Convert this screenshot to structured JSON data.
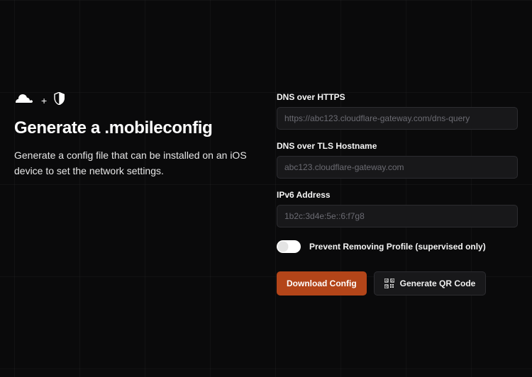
{
  "logos": {
    "plus": "+"
  },
  "left": {
    "title": "Generate a .mobileconfig",
    "subtitle": "Generate a config file that can be installed on an iOS device to set the network settings."
  },
  "fields": {
    "doh": {
      "label": "DNS over HTTPS",
      "placeholder": "https://abc123.cloudflare-gateway.com/dns-query"
    },
    "dot": {
      "label": "DNS over TLS Hostname",
      "placeholder": "abc123.cloudflare-gateway.com"
    },
    "ipv6": {
      "label": "IPv6 Address",
      "placeholder": "1b2c:3d4e:5e::6:f7g8"
    }
  },
  "toggle": {
    "label": "Prevent Removing Profile (supervised only)"
  },
  "buttons": {
    "download": "Download Config",
    "qr": "Generate QR Code"
  }
}
